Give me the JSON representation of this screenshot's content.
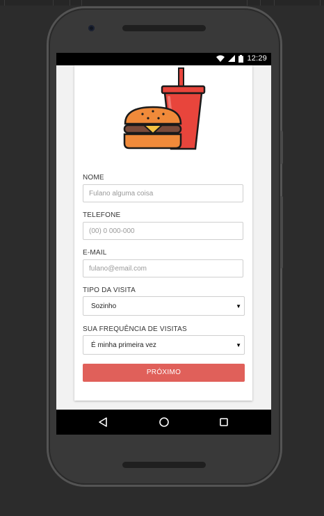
{
  "status_bar": {
    "time": "12:29"
  },
  "form": {
    "nome": {
      "label": "NOME",
      "placeholder": "Fulano alguma coisa"
    },
    "telefone": {
      "label": "TELEFONE",
      "placeholder": "(00) 0 000-000"
    },
    "email": {
      "label": "E-MAIL",
      "placeholder": "fulano@email.com"
    },
    "tipo_visita": {
      "label": "TIPO DA VISITA",
      "selected": "Sozinho"
    },
    "frequencia": {
      "label": "SUA FREQUÊNCIA DE VISITAS",
      "selected": "É minha primeira vez"
    },
    "submit_label": "PRÓXIMO"
  },
  "icons": {
    "logo": "burger-and-soda-icon",
    "back": "back-triangle-icon",
    "home": "home-circle-icon",
    "recents": "recents-square-icon"
  },
  "colors": {
    "accent": "#e0605a",
    "cup": "#e8453c",
    "bun": "#f08a3a",
    "patty": "#7a4a3a",
    "cheese": "#f5c242"
  }
}
